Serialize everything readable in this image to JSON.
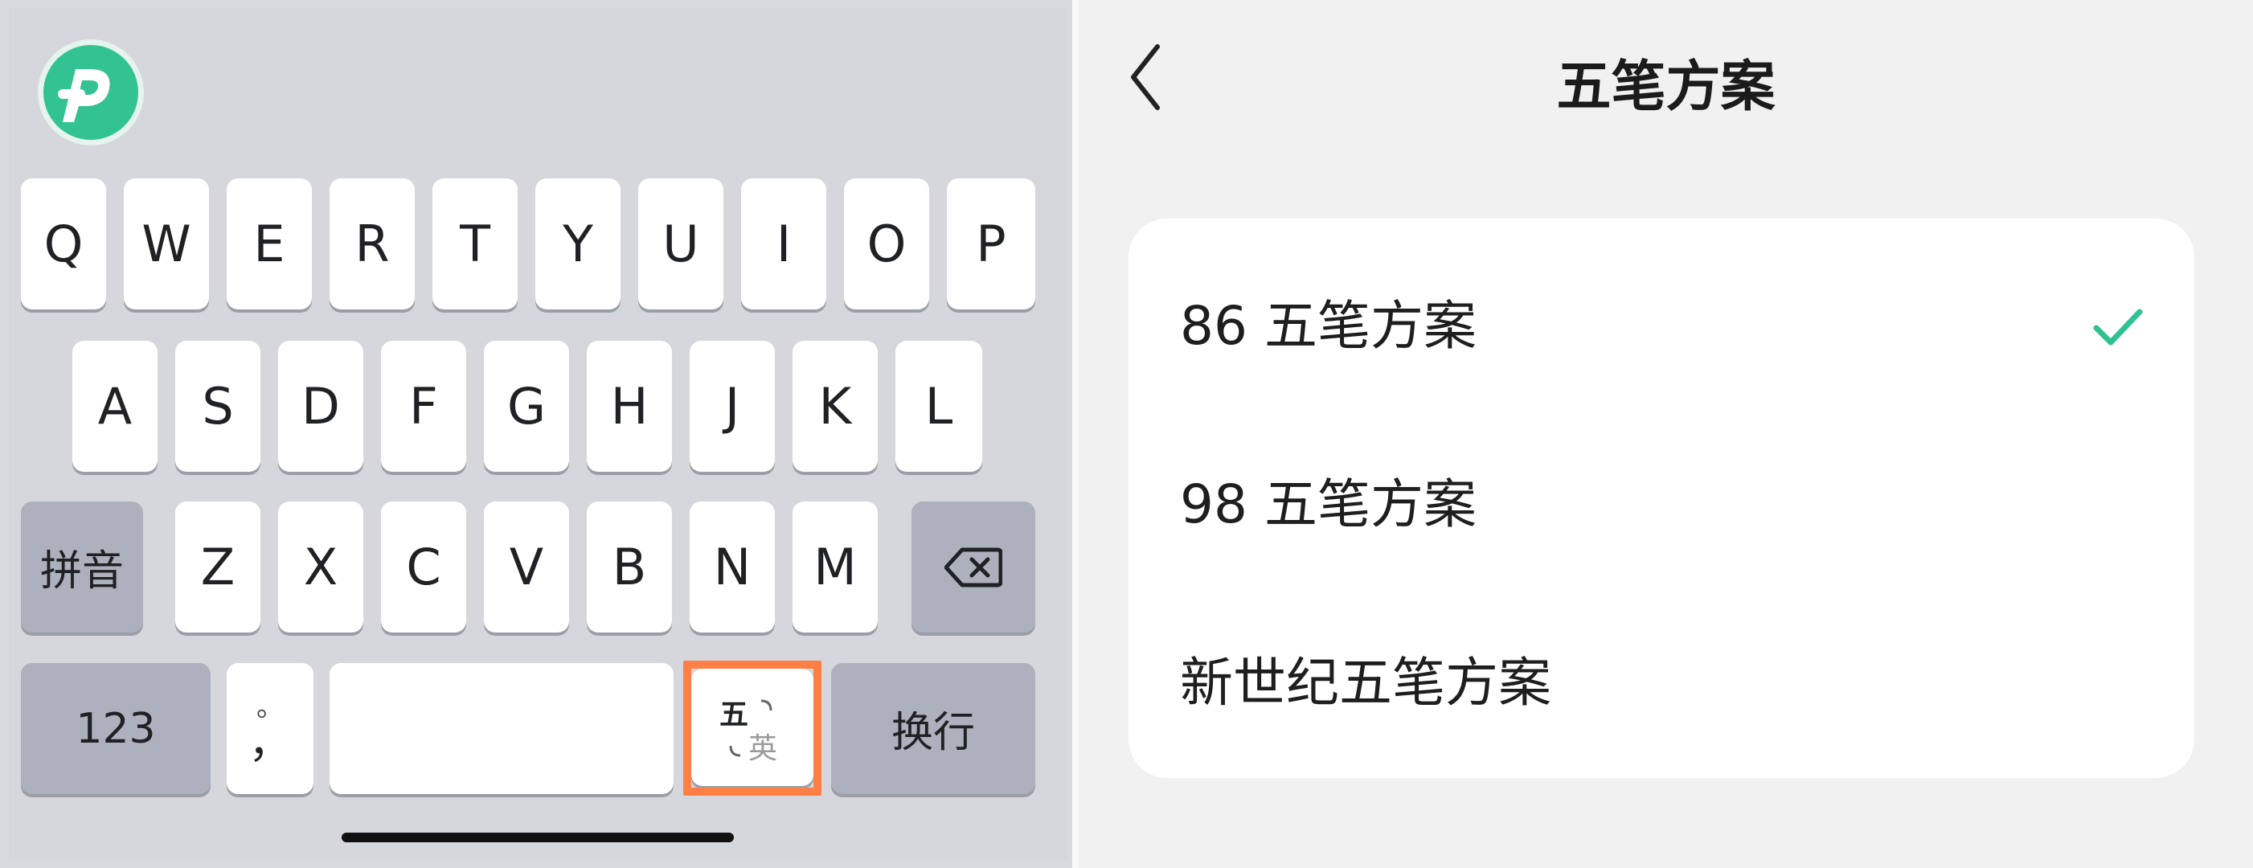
{
  "keyboard": {
    "row1": [
      "Q",
      "W",
      "E",
      "R",
      "T",
      "Y",
      "U",
      "I",
      "O",
      "P"
    ],
    "row2": [
      "A",
      "S",
      "D",
      "F",
      "G",
      "H",
      "J",
      "K",
      "L"
    ],
    "row3": [
      "Z",
      "X",
      "C",
      "V",
      "B",
      "N",
      "M"
    ],
    "pinyin_label": "拼音",
    "num_label": "123",
    "punct_top": "。",
    "punct_bottom": "，",
    "wubi_glyph": "五",
    "english_glyph": "英",
    "enter_label": "换行",
    "icons": {
      "logo": "app-logo-icon",
      "backspace": "backspace-icon"
    },
    "colors": {
      "logo": "#33c392",
      "highlight": "#ff7f45"
    }
  },
  "settings": {
    "title": "五笔方案",
    "back_icon": "chevron-left-icon",
    "options": [
      {
        "label": "86 五笔方案",
        "selected": true
      },
      {
        "label": "98 五笔方案",
        "selected": false
      },
      {
        "label": "新世纪五笔方案",
        "selected": false
      }
    ],
    "check_color": "#2fc28f"
  }
}
